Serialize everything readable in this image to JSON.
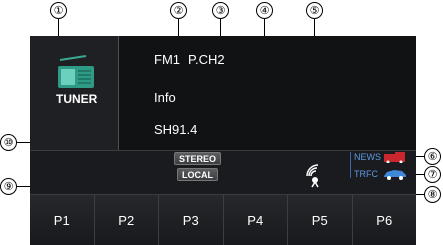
{
  "callouts": [
    "①",
    "②",
    "③",
    "④",
    "⑤",
    "⑥",
    "⑦",
    "⑧",
    "⑨",
    "⑩"
  ],
  "source": {
    "label": "TUNER",
    "icon": "radio-icon"
  },
  "display": {
    "band": "FM1",
    "preset_channel": "P.CH2",
    "info": "Info",
    "station": "SH91.4"
  },
  "status": {
    "stereo": "STEREO",
    "local": "LOCAL",
    "news": "NEWS",
    "trfc": "TRFC",
    "signal_icon": "signal-antenna-icon"
  },
  "presets": [
    "P1",
    "P2",
    "P3",
    "P4",
    "P5",
    "P6"
  ],
  "colors": {
    "screen_bg": "#111214",
    "tp_blue": "#5d98e6",
    "icon_teal": "#3aa894",
    "news_red": "#c8272d",
    "car_blue": "#3f87d8"
  }
}
